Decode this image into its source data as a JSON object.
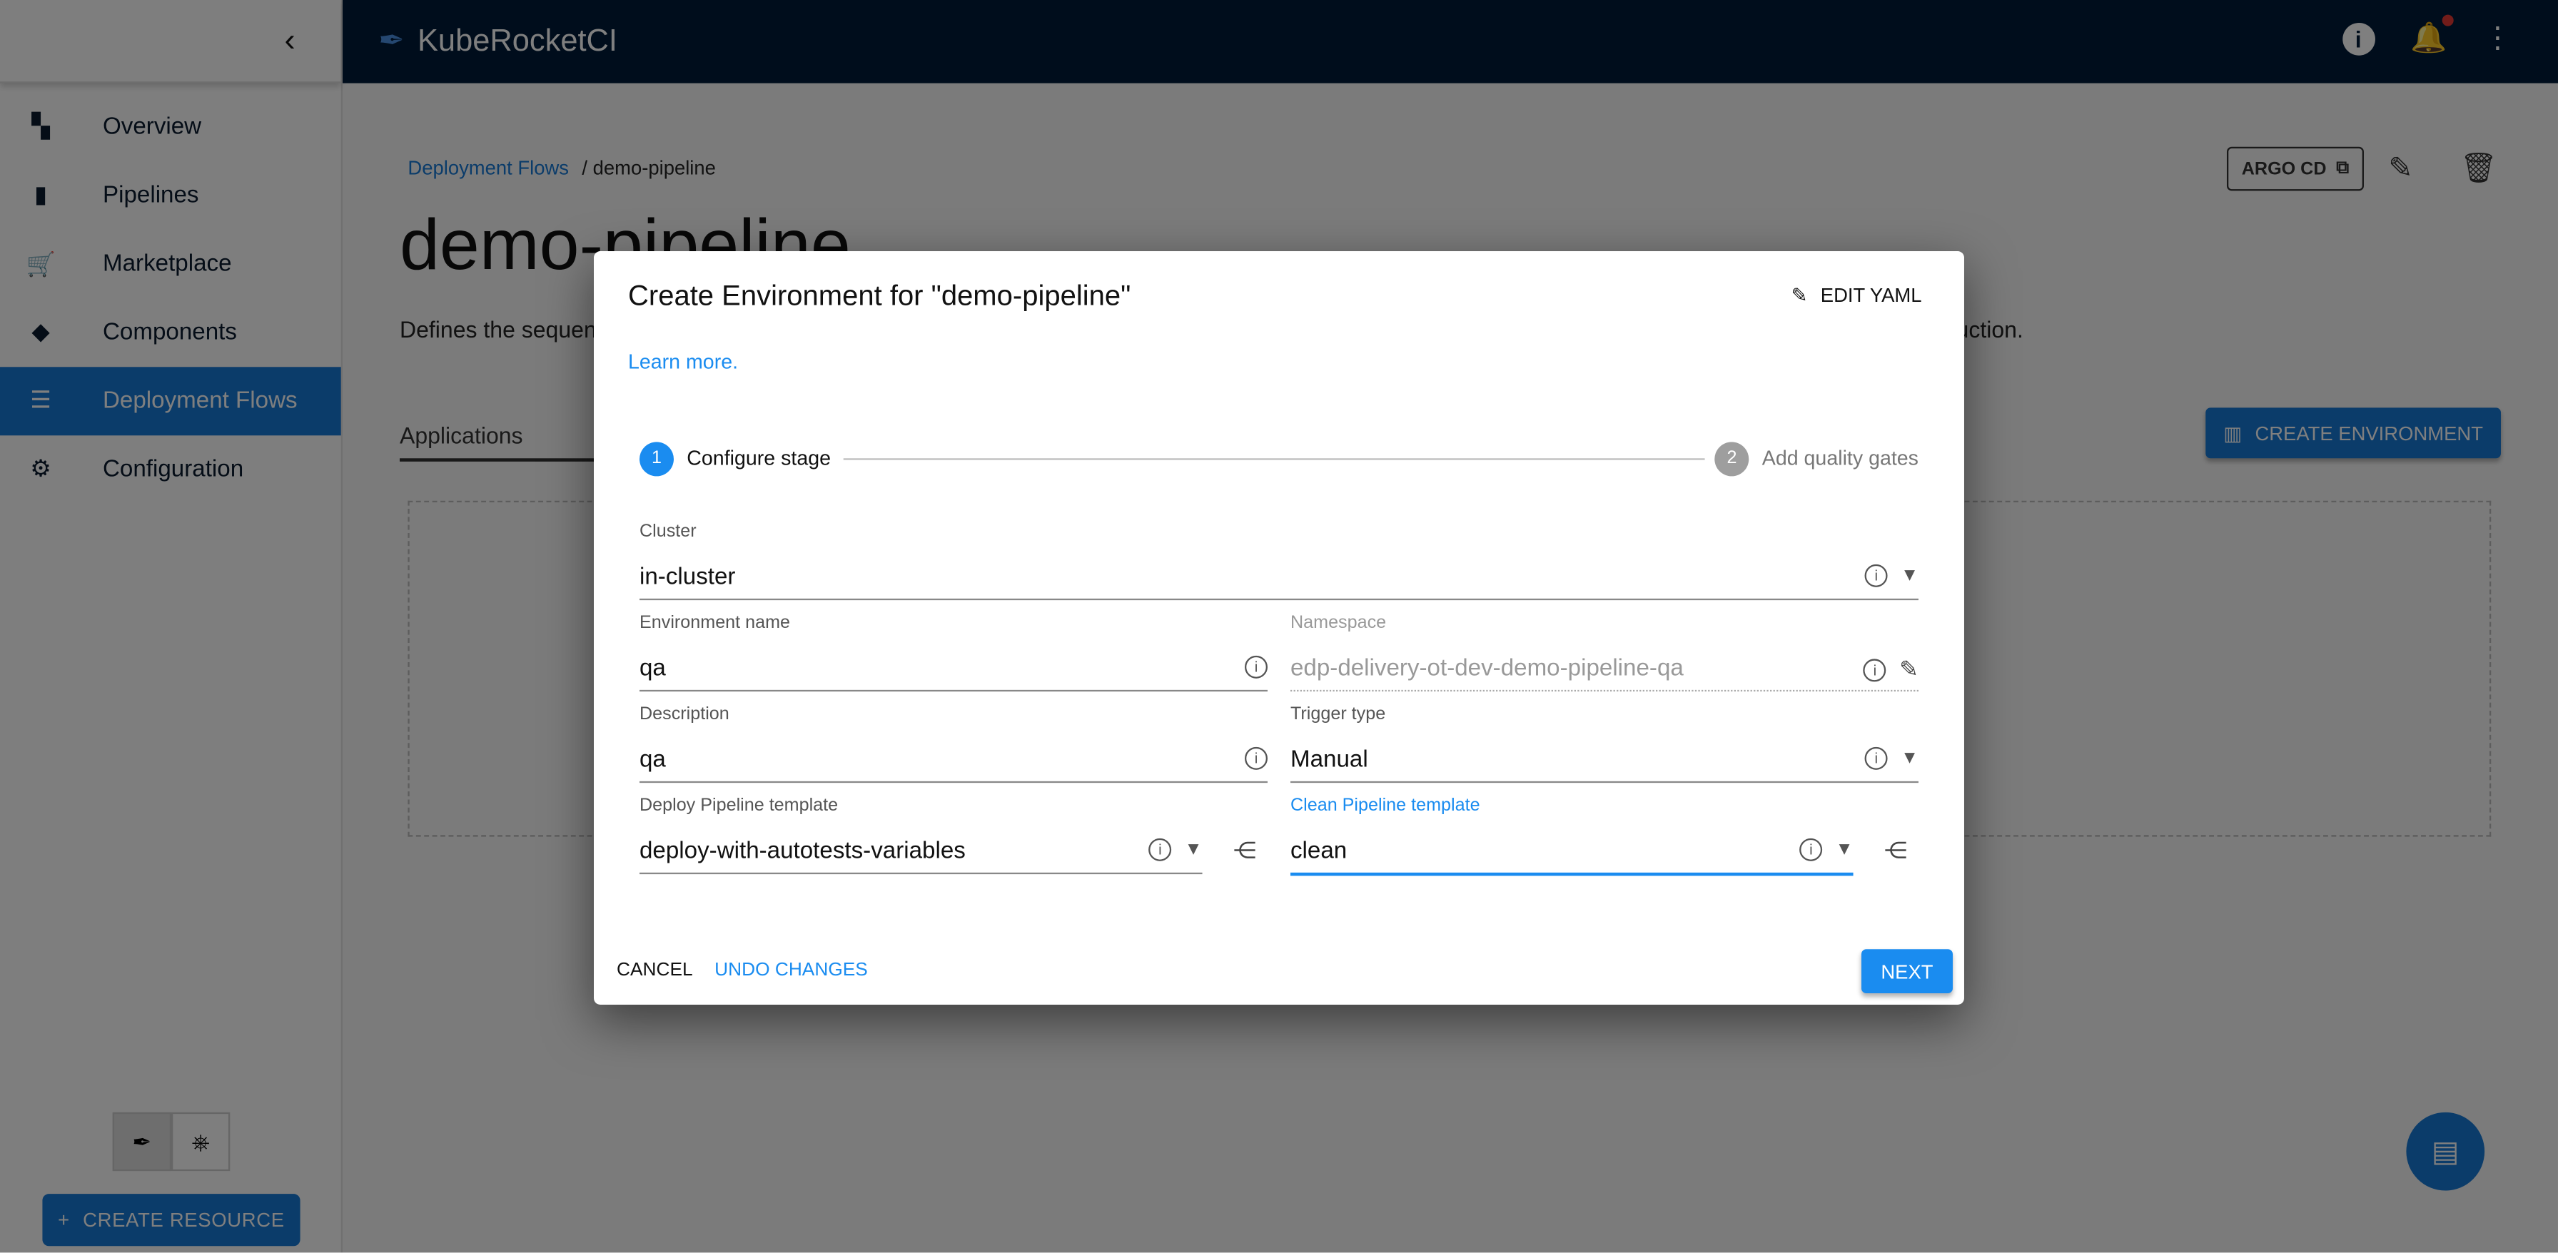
{
  "sidebar": {
    "collapse_icon": "chevron-left-icon",
    "items": [
      {
        "label": "Overview",
        "icon": "dashboard-icon"
      },
      {
        "label": "Pipelines",
        "icon": "pipelines-icon"
      },
      {
        "label": "Marketplace",
        "icon": "cart-icon"
      },
      {
        "label": "Components",
        "icon": "layers-icon"
      },
      {
        "label": "Deployment Flows",
        "icon": "flows-icon",
        "active": true
      },
      {
        "label": "Configuration",
        "icon": "gear-icon"
      }
    ],
    "create_resource": "CREATE RESOURCE"
  },
  "header": {
    "brand": "KubeRocketCI",
    "notification_color": "#e53935"
  },
  "page": {
    "breadcrumb_parent": "Deployment Flows",
    "breadcrumb_sep": "/",
    "breadcrumb_current": "demo-pipeline",
    "title": "demo-pipeline",
    "description": "Defines the sequen",
    "description_end": "uction.",
    "tab": "Applications",
    "argo": "ARGO CD",
    "create_env": "CREATE ENVIRONMENT"
  },
  "dialog": {
    "title": "Create Environment for \"demo-pipeline\"",
    "edit_yaml": "EDIT YAML",
    "learn_more": "Learn more.",
    "steps": [
      {
        "num": "1",
        "label": "Configure stage"
      },
      {
        "num": "2",
        "label": "Add quality gates"
      }
    ],
    "fields": {
      "cluster": {
        "label": "Cluster",
        "value": "in-cluster"
      },
      "env_name": {
        "label": "Environment name",
        "value": "qa"
      },
      "namespace": {
        "label": "Namespace",
        "value": "edp-delivery-ot-dev-demo-pipeline-qa"
      },
      "description": {
        "label": "Description",
        "value": "qa"
      },
      "trigger": {
        "label": "Trigger type",
        "value": "Manual"
      },
      "deploy_tpl": {
        "label": "Deploy Pipeline template",
        "value": "deploy-with-autotests-variables"
      },
      "clean_tpl": {
        "label": "Clean Pipeline template",
        "value": "clean"
      }
    },
    "cancel": "CANCEL",
    "undo": "UNDO CHANGES",
    "next": "NEXT",
    "accent": "#1a8cf0"
  }
}
